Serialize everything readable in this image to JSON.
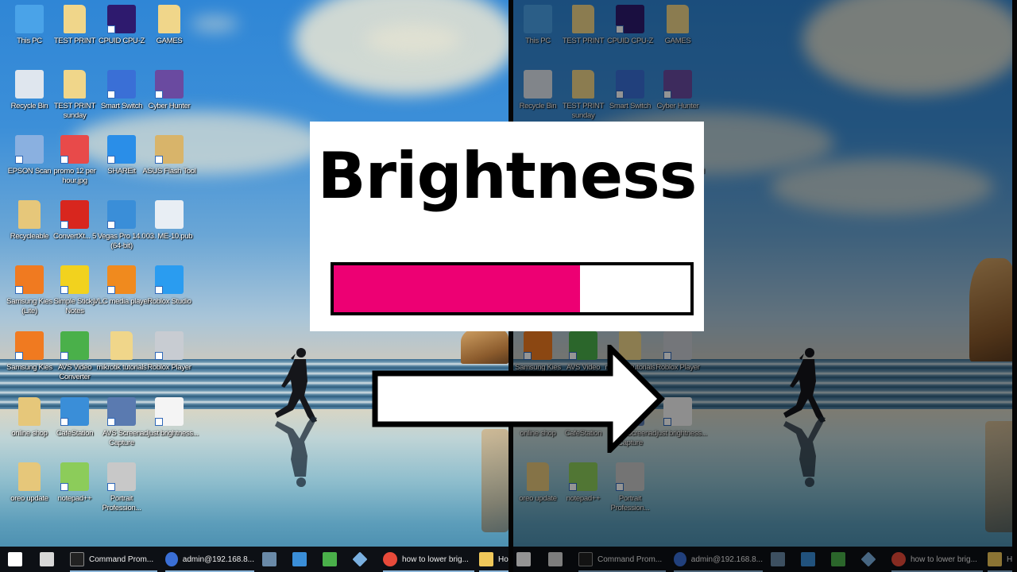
{
  "overlay": {
    "title": "Brightness",
    "brightness_level": 0.69,
    "fill_color": "#ed0073",
    "arrow_direction": "right-arrow"
  },
  "desktop_icons": [
    {
      "label": "This PC",
      "icon": "monitor-icon",
      "color": "#4aa3e8"
    },
    {
      "label": "TEST PRINT",
      "icon": "folder-icon",
      "color": "#f0d68a"
    },
    {
      "label": "CPUID CPU-Z",
      "icon": "cpu-icon",
      "color": "#2e1a6e"
    },
    {
      "label": "GAMES",
      "icon": "folder-icon",
      "color": "#f0d68a"
    },
    {
      "label": "Recycle Bin",
      "icon": "recycle-bin-icon",
      "color": "#dfe6ee"
    },
    {
      "label": "TEST PRINT sunday",
      "icon": "folder-icon",
      "color": "#f0d68a"
    },
    {
      "label": "Smart Switch",
      "icon": "smart-switch-icon",
      "color": "#3a6fd6"
    },
    {
      "label": "Cyber Hunter",
      "icon": "game-icon",
      "color": "#6a4aa0"
    },
    {
      "label": "EPSON Scan",
      "icon": "scanner-icon",
      "color": "#8ab0e0"
    },
    {
      "label": "promo 12 per hour.jpg",
      "icon": "image-icon",
      "color": "#e84a4a"
    },
    {
      "label": "SHAREit",
      "icon": "shareit-icon",
      "color": "#2a8ee8"
    },
    {
      "label": "ASUS Flash Tool",
      "icon": "box-icon",
      "color": "#d8b46a"
    },
    {
      "label": "Recycleable",
      "icon": "folder-icon",
      "color": "#e6c77a"
    },
    {
      "label": "ConvertXt... 5",
      "icon": "convertx-icon",
      "color": "#d8261e"
    },
    {
      "label": "Vegas Pro 14.0 (64-bit)",
      "icon": "vegas-icon",
      "color": "#3a8ed8"
    },
    {
      "label": "03. ME-10.pub",
      "icon": "publisher-file-icon",
      "color": "#e8eef4"
    },
    {
      "label": "Samsung Kies (Lite)",
      "icon": "kies-lite-icon",
      "color": "#f07a20"
    },
    {
      "label": "Simple Sticky Notes",
      "icon": "sticky-note-icon",
      "color": "#f2d21e"
    },
    {
      "label": "VLC media player",
      "icon": "vlc-icon",
      "color": "#f08a1e"
    },
    {
      "label": "Roblox Studio",
      "icon": "roblox-studio-icon",
      "color": "#2a9cf0"
    },
    {
      "label": "Samsung Kies",
      "icon": "kies-icon",
      "color": "#f07a20"
    },
    {
      "label": "AVS Video Converter",
      "icon": "avs-video-icon",
      "color": "#4ab04a"
    },
    {
      "label": "mikrotik tutorials",
      "icon": "folder-icon",
      "color": "#f0d68a"
    },
    {
      "label": "Roblox Player",
      "icon": "roblox-player-icon",
      "color": "#c8ccd2"
    },
    {
      "label": "online shop",
      "icon": "folder-icon",
      "color": "#e6c77a"
    },
    {
      "label": "CafeStation",
      "icon": "cafestation-icon",
      "color": "#3a8ed8"
    },
    {
      "label": "AVS Screen Capture",
      "icon": "screen-capture-icon",
      "color": "#5a7ab0"
    },
    {
      "label": "adjust brightness...",
      "icon": "video-file-icon",
      "color": "#f4f4f4"
    },
    {
      "label": "oreo update",
      "icon": "folder-icon",
      "color": "#e6c77a"
    },
    {
      "label": "notepad++",
      "icon": "notepad-plus-icon",
      "color": "#8ccc5a"
    },
    {
      "label": "Portrait Profession...",
      "icon": "camera-icon",
      "color": "#c8c8c8"
    }
  ],
  "right_pane_visible_labels": {
    "samsung": "Samsung",
    "avs": "AVS Video"
  },
  "taskbar": {
    "items": [
      {
        "label": "",
        "icon": "windows-start-icon"
      },
      {
        "label": "",
        "icon": "calculator-icon"
      },
      {
        "label": "Command Prom...",
        "icon": "command-prompt-icon"
      },
      {
        "label": "admin@192.168.8...",
        "icon": "winbox-icon"
      },
      {
        "label": "",
        "icon": "network-settings-icon"
      },
      {
        "label": "",
        "icon": "remote-desktop-icon"
      },
      {
        "label": "",
        "icon": "excel-icon"
      },
      {
        "label": "",
        "icon": "diamond-app-icon"
      },
      {
        "label": "how to lower brig...",
        "icon": "chrome-icon"
      },
      {
        "label": "Ho",
        "icon": "file-explorer-icon"
      }
    ]
  }
}
